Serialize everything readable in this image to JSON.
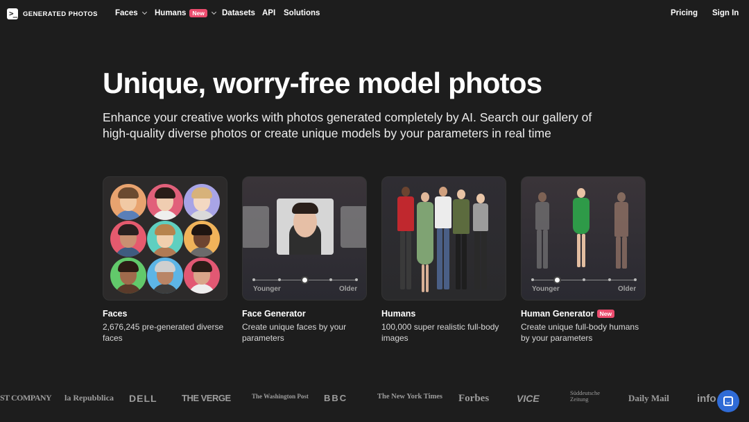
{
  "nav": {
    "logo_text": "GENERATED PHOTOS",
    "faces": "Faces",
    "humans": "Humans",
    "humans_badge": "New",
    "datasets": "Datasets",
    "api": "API",
    "solutions": "Solutions",
    "pricing": "Pricing",
    "sign_in": "Sign In"
  },
  "hero": {
    "title": "Unique, worry-free model photos",
    "subtitle": "Enhance your creative works with photos generated completely by AI. Search our gallery of high-quality diverse photos or create unique models by your parameters in real time"
  },
  "cards": [
    {
      "title": "Faces",
      "desc": "2,676,245 pre-generated diverse faces"
    },
    {
      "title": "Face Generator",
      "desc": "Create unique faces by your parameters",
      "slider_min": "Younger",
      "slider_max": "Older"
    },
    {
      "title": "Humans",
      "desc": "100,000 super realistic full-body images"
    },
    {
      "title": "Human Generator",
      "badge": "New",
      "desc": "Create unique full-body humans by your parameters",
      "slider_min": "Younger",
      "slider_max": "Older"
    }
  ],
  "press_logos": [
    "ST COMPANY",
    "la Repubblica",
    "DELL",
    "THE VERGE",
    "The Washington Post",
    "BBC",
    "The New York Times",
    "Forbes",
    "VICE",
    "Süddeutsche Zeitung",
    "Daily Mail",
    "info"
  ],
  "colors": {
    "background": "#1d1d1d",
    "badge": "#ec4c6e",
    "chat": "#2f6bd6"
  }
}
